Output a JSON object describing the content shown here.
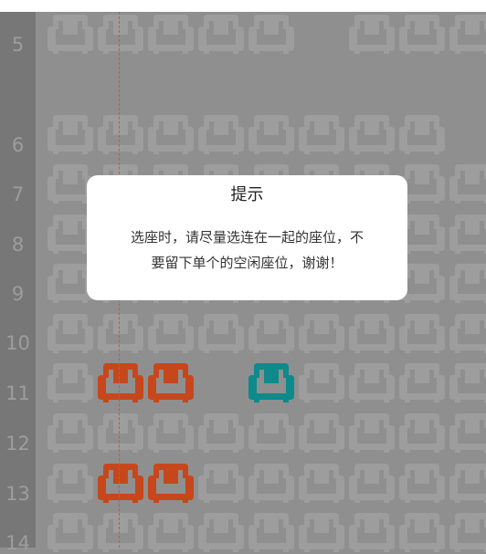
{
  "colors": {
    "available_seat": "#9d9d9d",
    "selected_seat": "#c7471c",
    "sold_seat": "#0c8a8c",
    "center_line": "#d0582c"
  },
  "rows": [
    "5",
    "6",
    "7",
    "8",
    "9",
    "10",
    "11",
    "12",
    "13",
    "14"
  ],
  "dialog": {
    "title": "提示",
    "message_line1": "选座时，请尽量选连在一起的座位，不",
    "message_line2": "要留下单个的空闲座位，谢谢！"
  },
  "seat_states": {
    "selected": [
      {
        "row": "11",
        "seat": 2
      },
      {
        "row": "11",
        "seat": 3
      },
      {
        "row": "13",
        "seat": 2
      },
      {
        "row": "13",
        "seat": 3
      }
    ],
    "teal": [
      {
        "row": "11",
        "seat": 5
      }
    ]
  },
  "icons": {
    "seat": "armchair-icon"
  }
}
